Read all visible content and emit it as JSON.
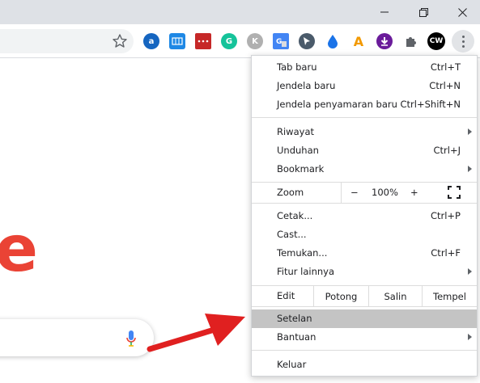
{
  "window": {
    "controls": [
      "minimize-icon",
      "restore-icon",
      "close-icon"
    ]
  },
  "toolbar": {
    "bookmark_icon": "star-icon",
    "extensions": [
      {
        "name": "a",
        "color": "#1565c0"
      },
      {
        "name": "grid",
        "color": "#1e88e5"
      },
      {
        "name": "dots",
        "color": "#c62828"
      },
      {
        "name": "G",
        "color": "#15c39a"
      },
      {
        "name": "K",
        "color": "#b0b0b0"
      },
      {
        "name": "translate",
        "color": "#4285f4"
      },
      {
        "name": "cursor",
        "color": "#4a5a6a"
      },
      {
        "name": "drop",
        "color": "#1a73e8"
      },
      {
        "name": "A",
        "color": "#f29900"
      },
      {
        "name": "download",
        "color": "#6a1b9a"
      },
      {
        "name": "puzzle",
        "color": "#5f6368"
      },
      {
        "name": "CW",
        "color": "#000000"
      }
    ],
    "ext_cw_label": "CW",
    "ext_a_label": "a",
    "ext_g_label": "G",
    "ext_k_label": "K",
    "ext_A_label": "A"
  },
  "page": {
    "logo_letter": "e",
    "accent": "#ea4335"
  },
  "menu": {
    "new_tab": "Tab baru",
    "new_tab_shortcut": "Ctrl+T",
    "new_window": "Jendela baru",
    "new_window_shortcut": "Ctrl+N",
    "incognito": "Jendela penyamaran baru",
    "incognito_shortcut": "Ctrl+Shift+N",
    "history": "Riwayat",
    "downloads": "Unduhan",
    "downloads_shortcut": "Ctrl+J",
    "bookmarks": "Bookmark",
    "zoom_label": "Zoom",
    "zoom_minus": "−",
    "zoom_value": "100%",
    "zoom_plus": "+",
    "print": "Cetak...",
    "print_shortcut": "Ctrl+P",
    "cast": "Cast...",
    "find": "Temukan...",
    "find_shortcut": "Ctrl+F",
    "more_tools": "Fitur lainnya",
    "edit_label": "Edit",
    "cut": "Potong",
    "copy": "Salin",
    "paste": "Tempel",
    "settings": "Setelan",
    "help": "Bantuan",
    "exit": "Keluar",
    "highlight_color": "#c4c4c4"
  },
  "annotation": {
    "arrow_color": "#e02020"
  }
}
